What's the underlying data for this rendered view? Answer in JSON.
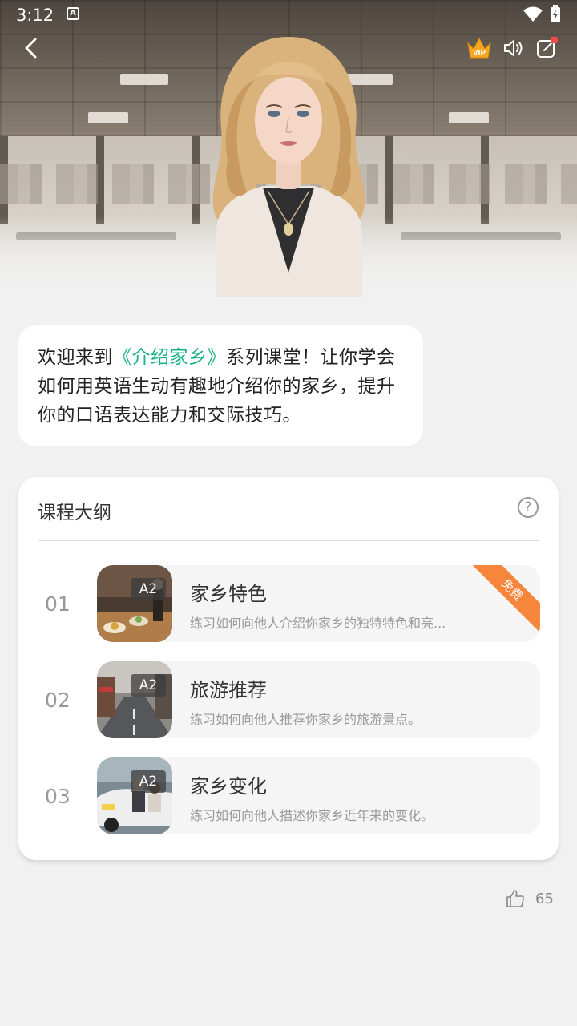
{
  "status_bar": {
    "time": "3:12",
    "sim_icon": "A"
  },
  "header": {
    "back_icon": "chevron-left-icon",
    "vip_label": "VIP",
    "sound_icon": "speaker-icon",
    "share_icon": "share-icon"
  },
  "welcome": {
    "prefix": "欢迎来到",
    "highlight": "《介绍家乡》",
    "suffix": "系列课堂！让你学会如何用英语生动有趣地介绍你的家乡，提升你的口语表达能力和交际技巧。",
    "highlight_color": "#19b38a"
  },
  "outline": {
    "title": "课程大纲",
    "help_icon": "?",
    "lessons": [
      {
        "num": "01",
        "level": "A2",
        "title": "家乡特色",
        "desc": "练习如何向他人介绍你家乡的独特特色和亮...",
        "badge": "免费"
      },
      {
        "num": "02",
        "level": "A2",
        "title": "旅游推荐",
        "desc": "练习如何向他人推荐你家乡的旅游景点。"
      },
      {
        "num": "03",
        "level": "A2",
        "title": "家乡变化",
        "desc": "练习如何向他人描述你家乡近年来的变化。"
      }
    ]
  },
  "footer": {
    "like_count": "65"
  },
  "colors": {
    "accent": "#19b38a",
    "badge": "#f5863b",
    "background": "#f1f1f1"
  }
}
